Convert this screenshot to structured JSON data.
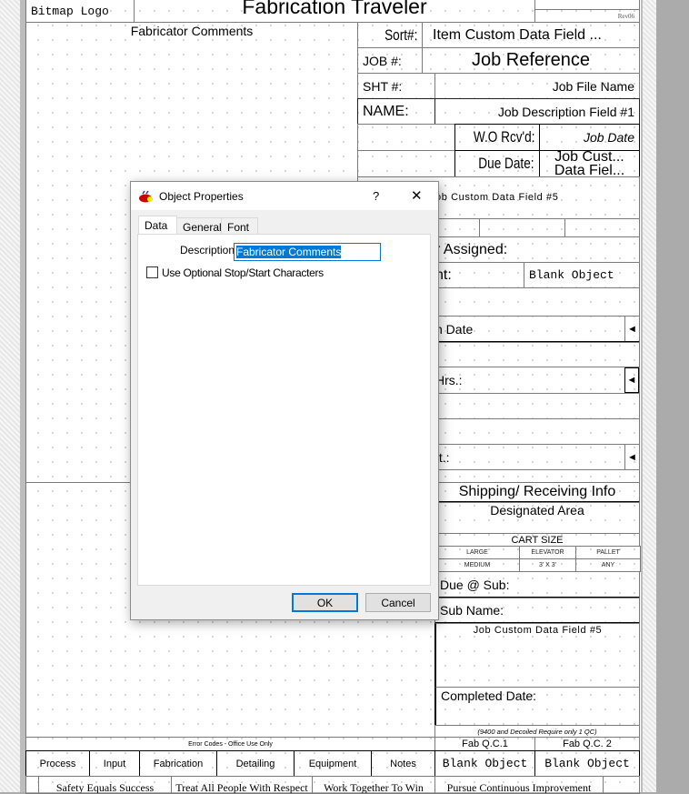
{
  "header": {
    "logo": "Bitmap Logo",
    "title": "Fabrication Traveler",
    "revision": "Rev06"
  },
  "left": {
    "comments_label": "Fabricator Comments"
  },
  "right": {
    "sort_label": "Sort#:",
    "sort_value": "Item Custom Data Field ...",
    "job_label": "JOB #:",
    "job_value": "Job Reference",
    "sht_label": "SHT #:",
    "sht_value": "Job File Name",
    "name_label": "NAME:",
    "name_value": "Job Description Field #1",
    "wo_label": "W.O Rcv'd:",
    "wo_value": "Job Date",
    "due_label": "Due Date:",
    "due_value_1": "Job Cust...",
    "due_value_2": "Data Fiel...",
    "custom5": "ob Custom Data Field #5",
    "assigned": "r Assigned:",
    "nt_label": "nt:",
    "nt_value": "Blank Object",
    "date_label": "h Date",
    "hrs_label": "Hrs.:",
    "wt_label": "/t.:",
    "arrow": "◄"
  },
  "shipping": {
    "title": "Shipping/ Receiving Info",
    "designated": "Designated Area",
    "cart_size": "CART SIZE",
    "cart_rows": [
      [
        "LARGE",
        "ELEVATOR",
        "PALLET"
      ],
      [
        "MEDIUM",
        "3' X 3'",
        "ANY"
      ]
    ],
    "due_sub": "Due @ Sub:",
    "sub_name": "Sub Name:",
    "custom5": "Job Custom Data Field #5",
    "completed": "Completed Date:",
    "qc_note": "(9400 and Decoiled Require only 1 QC)"
  },
  "footer": {
    "error_codes": "Error Codes - Office Use Only",
    "qc1": "Fab Q.C.1",
    "qc2": "Fab Q.C. 2",
    "categories": [
      "Process",
      "Input",
      "Fabrication",
      "Detailing",
      "Equipment",
      "Notes"
    ],
    "blank1": "Blank Object",
    "blank2": "Blank Object",
    "mottos": [
      "Safety Equals Success",
      "Treat All People With Respect",
      "Work Together To Win",
      "Pursue Continuous Improvement"
    ]
  },
  "dialog": {
    "title": "Object Properties",
    "help": "?",
    "close": "✕",
    "tabs": [
      "Data",
      "General",
      "Font"
    ],
    "description_label": "Description",
    "description_value": "Fabricator Comments",
    "checkbox_label": "Use Optional Stop/Start Characters",
    "checkbox_checked": false,
    "ok": "OK",
    "cancel": "Cancel"
  }
}
